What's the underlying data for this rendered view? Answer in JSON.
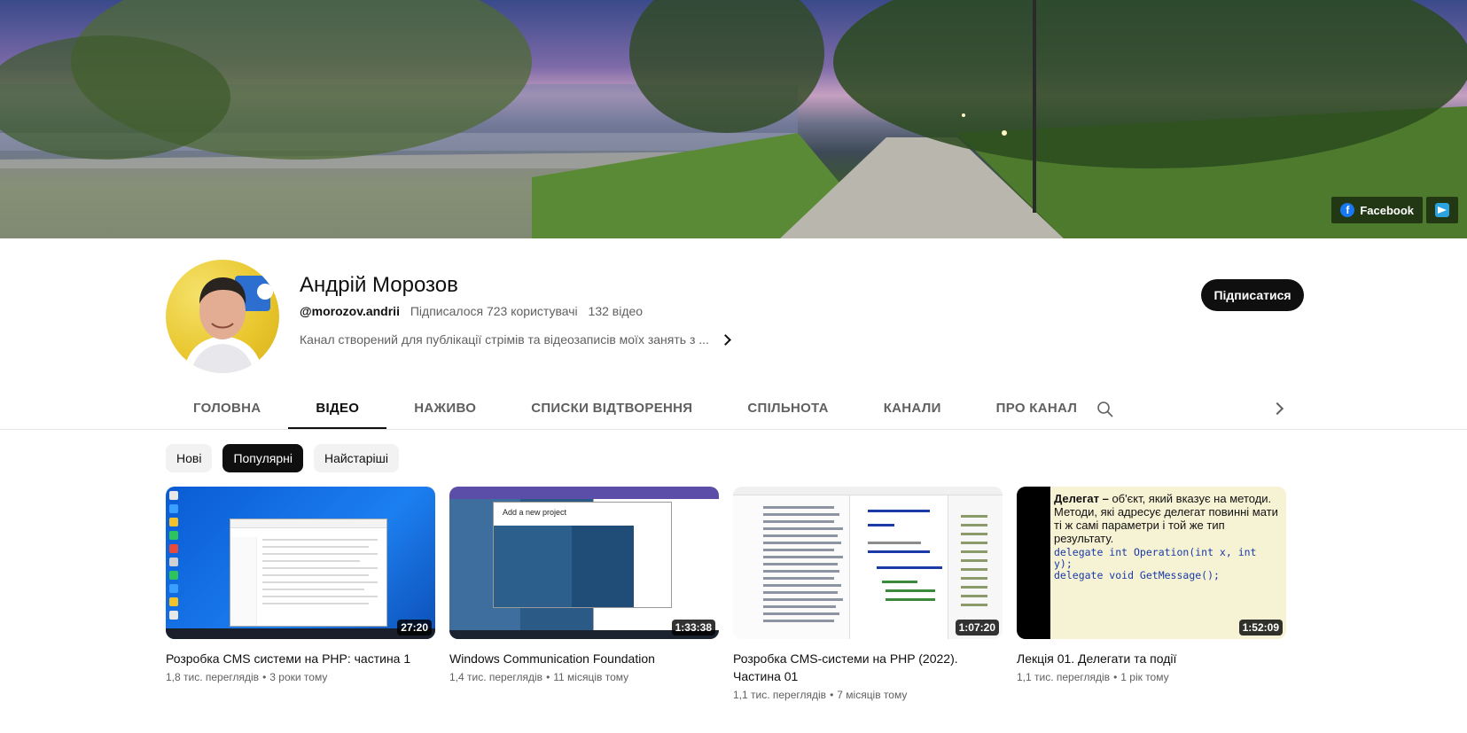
{
  "banner": {
    "links": [
      {
        "label": "Facebook",
        "icon": "facebook-icon"
      },
      {
        "label": "",
        "icon": "telegram-icon"
      }
    ]
  },
  "channel": {
    "name": "Андрій Морозов",
    "handle": "@morozov.andrii",
    "subscribers": "Підписалося 723 користувачі",
    "video_count": "132 відео",
    "description": "Канал створений для публікації стрімів та відеозаписів моїх занять з ...",
    "subscribe_label": "Підписатися"
  },
  "tabs": [
    {
      "label": "ГОЛОВНА",
      "active": false
    },
    {
      "label": "ВІДЕО",
      "active": true
    },
    {
      "label": "НАЖИВО",
      "active": false
    },
    {
      "label": "СПИСКИ ВІДТВОРЕННЯ",
      "active": false
    },
    {
      "label": "СПІЛЬНОТА",
      "active": false
    },
    {
      "label": "КАНАЛИ",
      "active": false
    },
    {
      "label": "ПРО КАНАЛ",
      "active": false
    }
  ],
  "chips": [
    {
      "label": "Нові",
      "active": false
    },
    {
      "label": "Популярні",
      "active": true
    },
    {
      "label": "Найстаріші",
      "active": false
    }
  ],
  "videos": [
    {
      "title": "Розробка CMS системи на PHP: частина 1",
      "duration": "27:20",
      "views": "1,8 тис. переглядів",
      "age": "3 роки тому"
    },
    {
      "title": "Windows Communication Foundation",
      "duration": "1:33:38",
      "views": "1,4 тис. переглядів",
      "age": "11 місяців тому",
      "thumb_text": "Add a new project"
    },
    {
      "title": "Розробка CMS-системи на PHP (2022). Частина 01",
      "duration": "1:07:20",
      "views": "1,1 тис. переглядів",
      "age": "7 місяців тому"
    },
    {
      "title": "Лекція 01. Делегати та події",
      "duration": "1:52:09",
      "views": "1,1 тис. переглядів",
      "age": "1 рік тому",
      "thumb_text": {
        "lead": "Делегат –",
        "body": " об'єкт, який вказує на методи. Методи, які адресує делегат повинні мати ті ж самі параметри і той же тип результату.",
        "code1": "delegate int Operation(int x, int y);",
        "code2": "delegate void GetMessage();"
      }
    }
  ],
  "colors": {
    "subscribe_bg": "#0f0f0f",
    "chip_bg": "#f2f2f2",
    "meta_text": "#606060"
  }
}
